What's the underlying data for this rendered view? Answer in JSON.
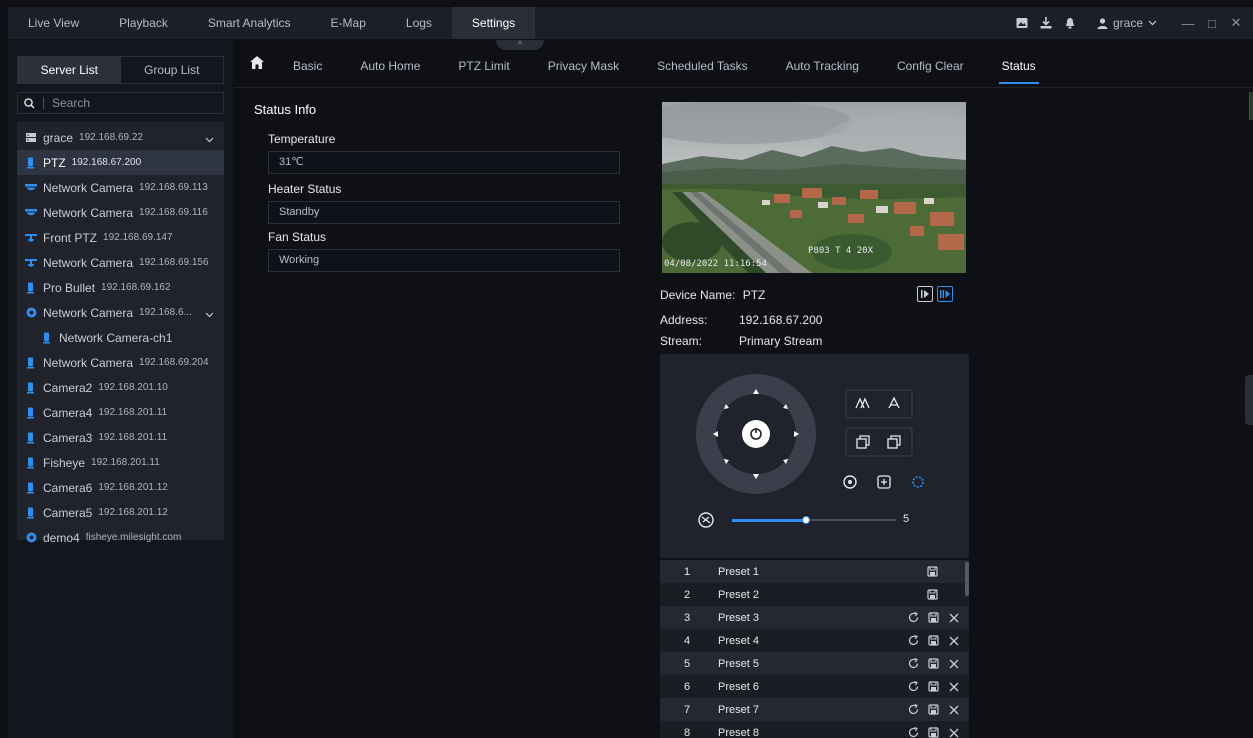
{
  "topnav": {
    "items": [
      "Live View",
      "Playback",
      "Smart Analytics",
      "E-Map",
      "Logs",
      "Settings"
    ],
    "active_index": 5
  },
  "user": {
    "name": "grace"
  },
  "left": {
    "tabs": [
      "Server List",
      "Group List"
    ],
    "search_placeholder": "Search",
    "tree": [
      {
        "name": "grace",
        "ip": "192.168.69.22",
        "icon": "server-icon",
        "type": "server"
      },
      {
        "name": "PTZ",
        "ip": "192.168.67.200",
        "icon": "camera-bullet-icon",
        "type": "selected"
      },
      {
        "name": "Network Camera",
        "ip": "192.168.69.113",
        "icon": "dome-camera-icon"
      },
      {
        "name": "Network Camera",
        "ip": "192.168.69.116",
        "icon": "dome-camera-icon"
      },
      {
        "name": "Front PTZ",
        "ip": "192.168.69.147",
        "icon": "ptz-camera-icon"
      },
      {
        "name": "Network Camera",
        "ip": "192.168.69.156",
        "icon": "ptz-camera-icon"
      },
      {
        "name": "Pro Bullet",
        "ip": "192.168.69.162",
        "icon": "camera-bullet-icon"
      },
      {
        "name": "Network Camera",
        "ip": "192.168.6...",
        "icon": "nvr-icon",
        "type": "group"
      },
      {
        "name": "Network Camera-ch1",
        "ip": "",
        "icon": "camera-bullet-icon",
        "type": "child"
      },
      {
        "name": "Network Camera",
        "ip": "192.168.69.204",
        "icon": "camera-bullet-icon"
      },
      {
        "name": "Camera2",
        "ip": "192.168.201.10",
        "icon": "camera-bullet-icon"
      },
      {
        "name": "Camera4",
        "ip": "192.168.201.11",
        "icon": "camera-bullet-icon"
      },
      {
        "name": "Camera3",
        "ip": "192.168.201.11",
        "icon": "camera-bullet-icon"
      },
      {
        "name": "Fisheye",
        "ip": "192.168.201.11",
        "icon": "camera-bullet-icon"
      },
      {
        "name": "Camera6",
        "ip": "192.168.201.12",
        "icon": "camera-bullet-icon"
      },
      {
        "name": "Camera5",
        "ip": "192.168.201.12",
        "icon": "camera-bullet-icon"
      },
      {
        "name": "demo4",
        "ip": "fisheye.milesight.com",
        "icon": "nvr-icon"
      }
    ]
  },
  "subnav": {
    "tabs": [
      "Basic",
      "Auto Home",
      "PTZ Limit",
      "Privacy Mask",
      "Scheduled Tasks",
      "Auto Tracking",
      "Config Clear",
      "Status"
    ],
    "active_index": 7
  },
  "status": {
    "heading": "Status Info",
    "temperature_label": "Temperature",
    "temperature_value": "31℃",
    "heater_label": "Heater Status",
    "heater_value": "Standby",
    "fan_label": "Fan Status",
    "fan_value": "Working"
  },
  "preview": {
    "osd_camera": "P803 T 4  20X",
    "osd_time": "04/08/2022 11:16:54"
  },
  "device": {
    "name_label": "Device Name:",
    "name_value": "PTZ",
    "address_label": "Address:",
    "address_value": "192.168.67.200",
    "stream_label": "Stream:",
    "stream_value": "Primary Stream"
  },
  "ptz": {
    "speed_value": "5",
    "speed_fraction": 0.5
  },
  "presets": [
    {
      "num": "1",
      "name": "Preset 1",
      "set": false
    },
    {
      "num": "2",
      "name": "Preset 2",
      "set": false
    },
    {
      "num": "3",
      "name": "Preset 3",
      "set": true
    },
    {
      "num": "4",
      "name": "Preset 4",
      "set": true
    },
    {
      "num": "5",
      "name": "Preset 5",
      "set": true
    },
    {
      "num": "6",
      "name": "Preset 6",
      "set": true
    },
    {
      "num": "7",
      "name": "Preset 7",
      "set": true
    },
    {
      "num": "8",
      "name": "Preset 8",
      "set": true
    }
  ],
  "colors": {
    "accent": "#2e8ff0",
    "panel": "#20232b",
    "background": "#0e1016"
  }
}
